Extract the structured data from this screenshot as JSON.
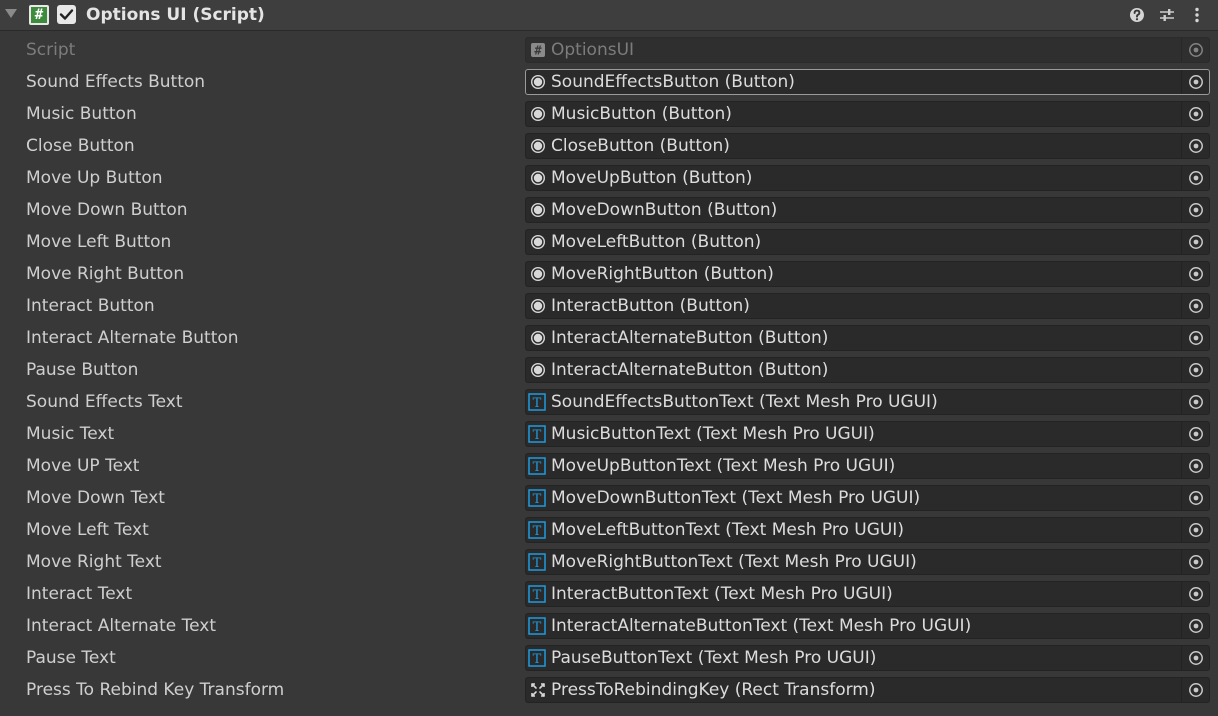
{
  "component": {
    "title": "Options UI (Script)",
    "enabled": true
  },
  "header_icons": [
    "help-icon",
    "preset-icon",
    "menu-icon"
  ],
  "colors": {
    "panel_bg": "#383838",
    "field_bg": "#2a2a2a",
    "tmp_icon": "#1e9be0",
    "script_icon": "#3c8c3c"
  },
  "fields": [
    {
      "label": "Script",
      "value": "OptionsUI",
      "icon": "script-icon",
      "disabled": true
    },
    {
      "label": "Sound Effects Button",
      "value": "SoundEffectsButton (Button)",
      "icon": "button-icon",
      "focused": true
    },
    {
      "label": "Music Button",
      "value": "MusicButton (Button)",
      "icon": "button-icon"
    },
    {
      "label": "Close Button",
      "value": "CloseButton (Button)",
      "icon": "button-icon"
    },
    {
      "label": "Move Up Button",
      "value": "MoveUpButton (Button)",
      "icon": "button-icon"
    },
    {
      "label": "Move Down Button",
      "value": "MoveDownButton (Button)",
      "icon": "button-icon"
    },
    {
      "label": "Move Left Button",
      "value": "MoveLeftButton (Button)",
      "icon": "button-icon"
    },
    {
      "label": "Move Right Button",
      "value": "MoveRightButton (Button)",
      "icon": "button-icon"
    },
    {
      "label": "Interact Button",
      "value": "InteractButton (Button)",
      "icon": "button-icon"
    },
    {
      "label": "Interact Alternate Button",
      "value": "InteractAlternateButton (Button)",
      "icon": "button-icon"
    },
    {
      "label": "Pause Button",
      "value": "InteractAlternateButton (Button)",
      "icon": "button-icon"
    },
    {
      "label": "Sound Effects Text",
      "value": "SoundEffectsButtonText (Text Mesh Pro UGUI)",
      "icon": "text-mesh-pro-icon"
    },
    {
      "label": "Music Text",
      "value": "MusicButtonText (Text Mesh Pro UGUI)",
      "icon": "text-mesh-pro-icon"
    },
    {
      "label": "Move UP Text",
      "value": "MoveUpButtonText (Text Mesh Pro UGUI)",
      "icon": "text-mesh-pro-icon"
    },
    {
      "label": "Move Down Text",
      "value": "MoveDownButtonText (Text Mesh Pro UGUI)",
      "icon": "text-mesh-pro-icon"
    },
    {
      "label": "Move Left Text",
      "value": "MoveLeftButtonText (Text Mesh Pro UGUI)",
      "icon": "text-mesh-pro-icon"
    },
    {
      "label": "Move Right Text",
      "value": "MoveRightButtonText (Text Mesh Pro UGUI)",
      "icon": "text-mesh-pro-icon"
    },
    {
      "label": "Interact Text",
      "value": "InteractButtonText (Text Mesh Pro UGUI)",
      "icon": "text-mesh-pro-icon"
    },
    {
      "label": "Interact Alternate Text",
      "value": "InteractAlternateButtonText (Text Mesh Pro UGUI)",
      "icon": "text-mesh-pro-icon"
    },
    {
      "label": "Pause Text",
      "value": "PauseButtonText (Text Mesh Pro UGUI)",
      "icon": "text-mesh-pro-icon"
    },
    {
      "label": "Press To Rebind Key Transform",
      "value": "PressToRebindingKey (Rect Transform)",
      "icon": "rect-transform-icon"
    }
  ]
}
